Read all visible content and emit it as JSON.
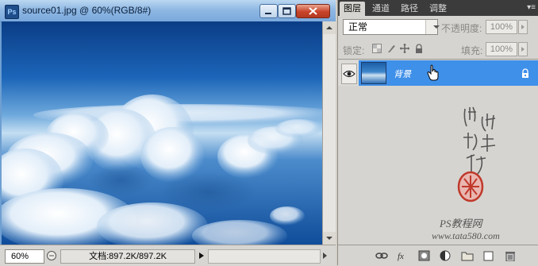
{
  "document": {
    "title": "source01.jpg @ 60%(RGB/8#)",
    "app_icon_label": "Ps",
    "zoom": "60%",
    "doc_size": "文档:897.2K/897.2K"
  },
  "layers_panel": {
    "tabs": [
      "图层",
      "通道",
      "路径",
      "调整"
    ],
    "active_tab_index": 0,
    "blend_mode": "正常",
    "opacity_label": "不透明度:",
    "opacity_value": "100%",
    "lock_label": "锁定:",
    "fill_label": "填充:",
    "fill_value": "100%",
    "layers": [
      {
        "name": "背景",
        "visible": true,
        "locked": true,
        "selected": true
      }
    ]
  },
  "watermark": {
    "handwriting": "他她我帮你",
    "footer_line1": "PS教程网",
    "footer_line2": "www.tata580.com"
  },
  "colors": {
    "selection": "#3f90e9",
    "titlebar": "#8fb8e3",
    "close_button": "#c8432a"
  }
}
